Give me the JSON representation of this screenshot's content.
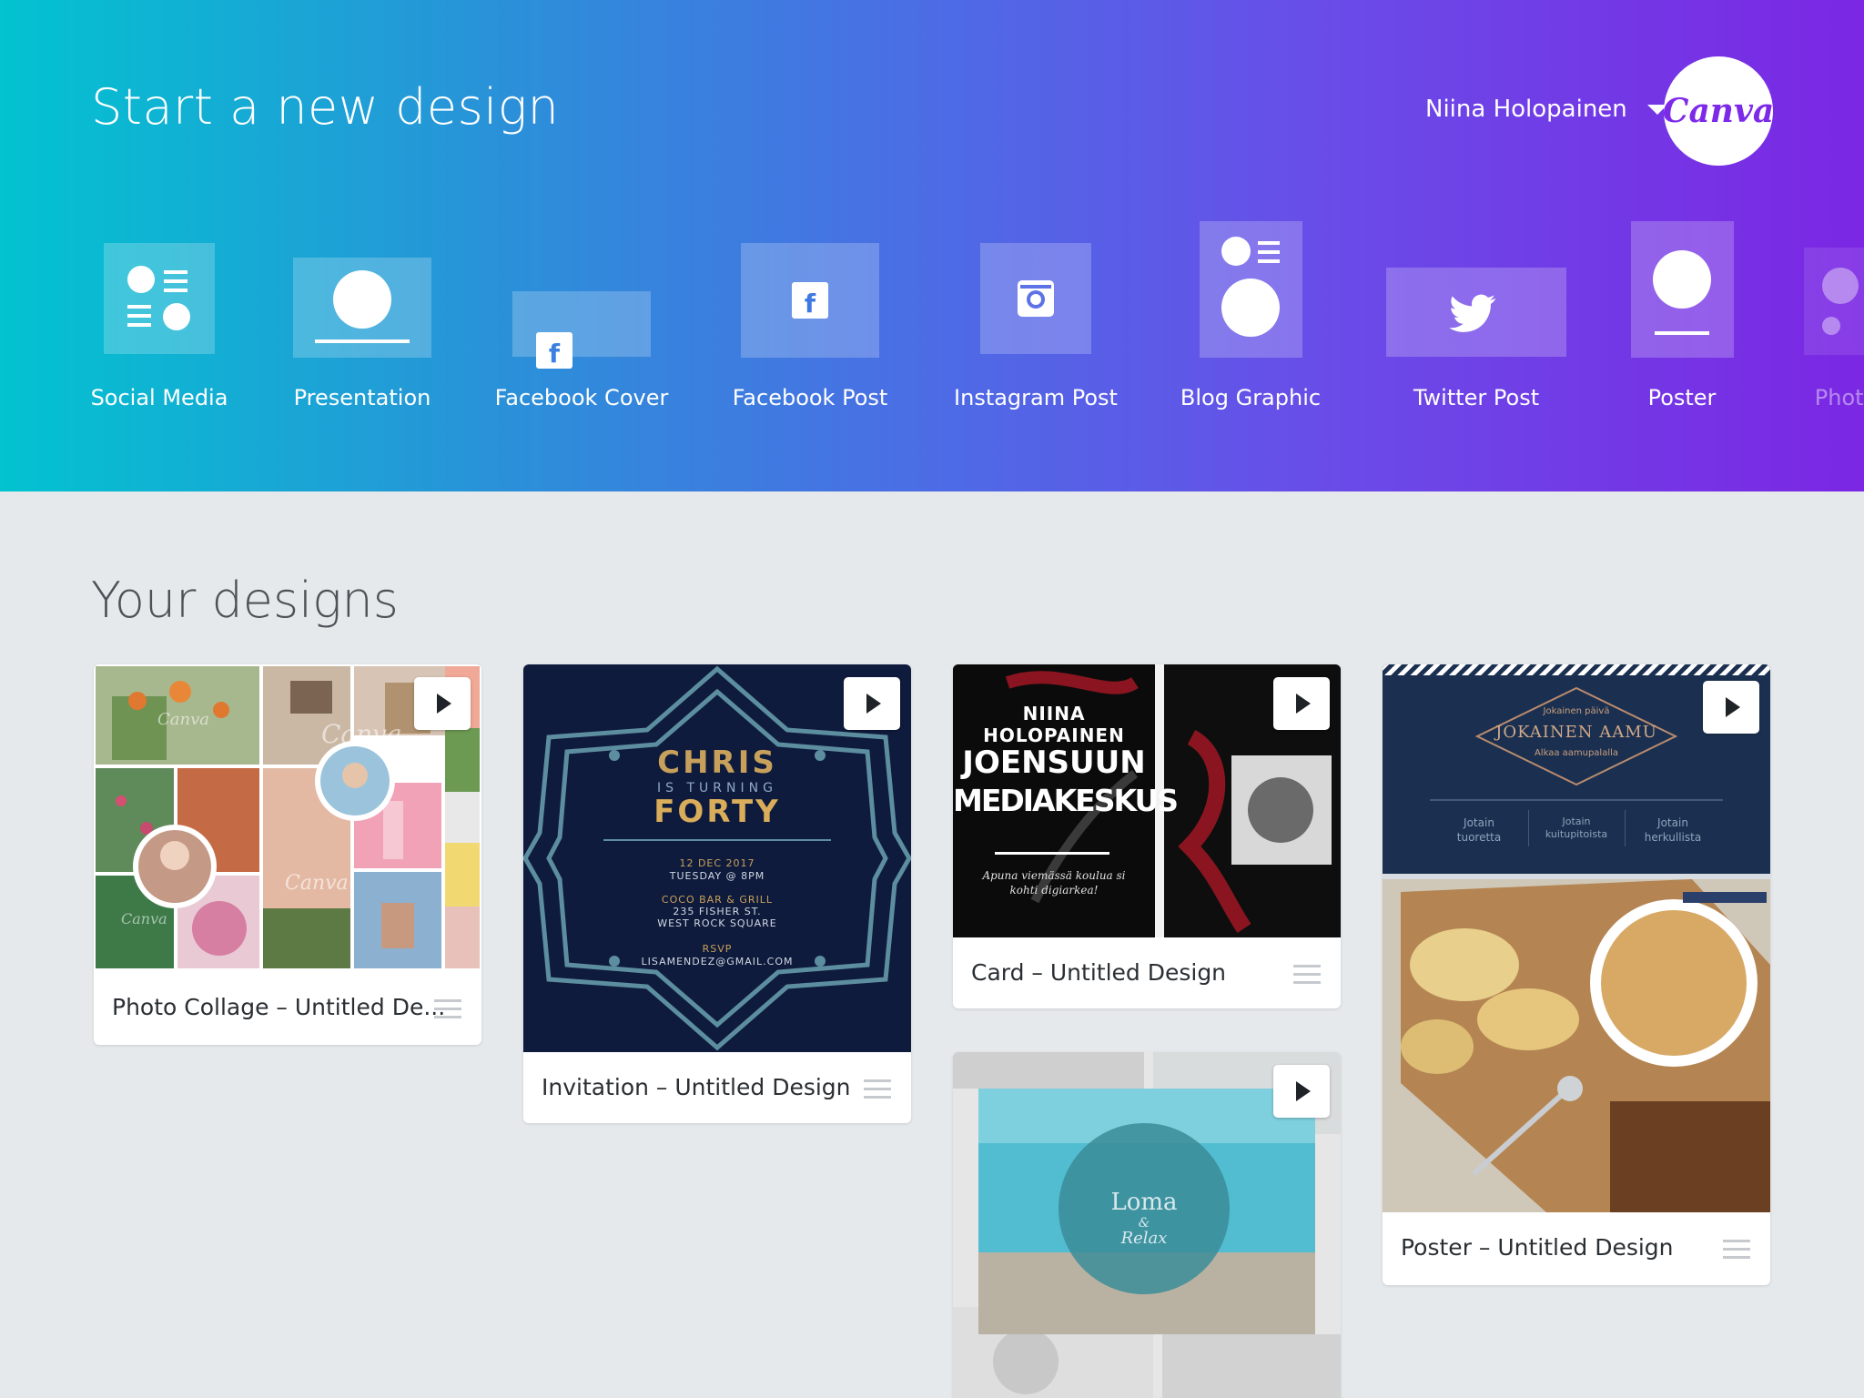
{
  "header": {
    "title": "Start a new design",
    "user_name": "Niina Holopainen",
    "logo_text": "Canva"
  },
  "design_types": [
    {
      "label": "Social Media",
      "icon": "social-media-icon"
    },
    {
      "label": "Presentation",
      "icon": "presentation-icon"
    },
    {
      "label": "Facebook Cover",
      "icon": "facebook-cover-icon"
    },
    {
      "label": "Facebook Post",
      "icon": "facebook-post-icon"
    },
    {
      "label": "Instagram Post",
      "icon": "instagram-icon"
    },
    {
      "label": "Blog Graphic",
      "icon": "blog-graphic-icon"
    },
    {
      "label": "Twitter Post",
      "icon": "twitter-icon"
    },
    {
      "label": "Poster",
      "icon": "poster-icon"
    },
    {
      "label": "Photo",
      "icon": "photo-collage-icon"
    }
  ],
  "designs_section": {
    "title": "Your designs",
    "cards": [
      {
        "title": "Photo Collage – Untitled De...",
        "watermarks": [
          "Canva",
          "Canva",
          "Canva",
          "Canva"
        ]
      },
      {
        "title": "Invitation – Untitled Design",
        "thumb": {
          "name": "CHRIS",
          "subtitle": "IS TURNING",
          "age": "FORTY",
          "date": "12 DEC 2017",
          "day": "TUESDAY @ 8PM",
          "venue": "COCO BAR & GRILL",
          "street": "235 FISHER ST.",
          "place": "WEST ROCK SQUARE",
          "rsvp": "RSVP",
          "email": "LISAMENDEZ@GMAIL.COM"
        }
      },
      {
        "title": "Card – Untitled Design",
        "thumb": {
          "person": "NIINA HOLOPAINEN",
          "line1": "JOENSUUN",
          "line2": "MEDIAKESKUS",
          "tagline": "Apuna viemässä koulua si kohti digiarkea!"
        }
      },
      {
        "title": "Poster – Untitled Design",
        "thumb": {
          "small": "Jokainen päivä",
          "headline": "JOKAINEN AAMU",
          "sub": "Alkaa aamupalalla",
          "col1": "Jotain tuoretta",
          "col2": "Jotain kuitupitoista",
          "col3": "Jotain herkullista"
        }
      },
      {
        "title": "",
        "thumb": {
          "word": "Loma",
          "amp": "&",
          "word2": "Relax"
        }
      }
    ]
  }
}
